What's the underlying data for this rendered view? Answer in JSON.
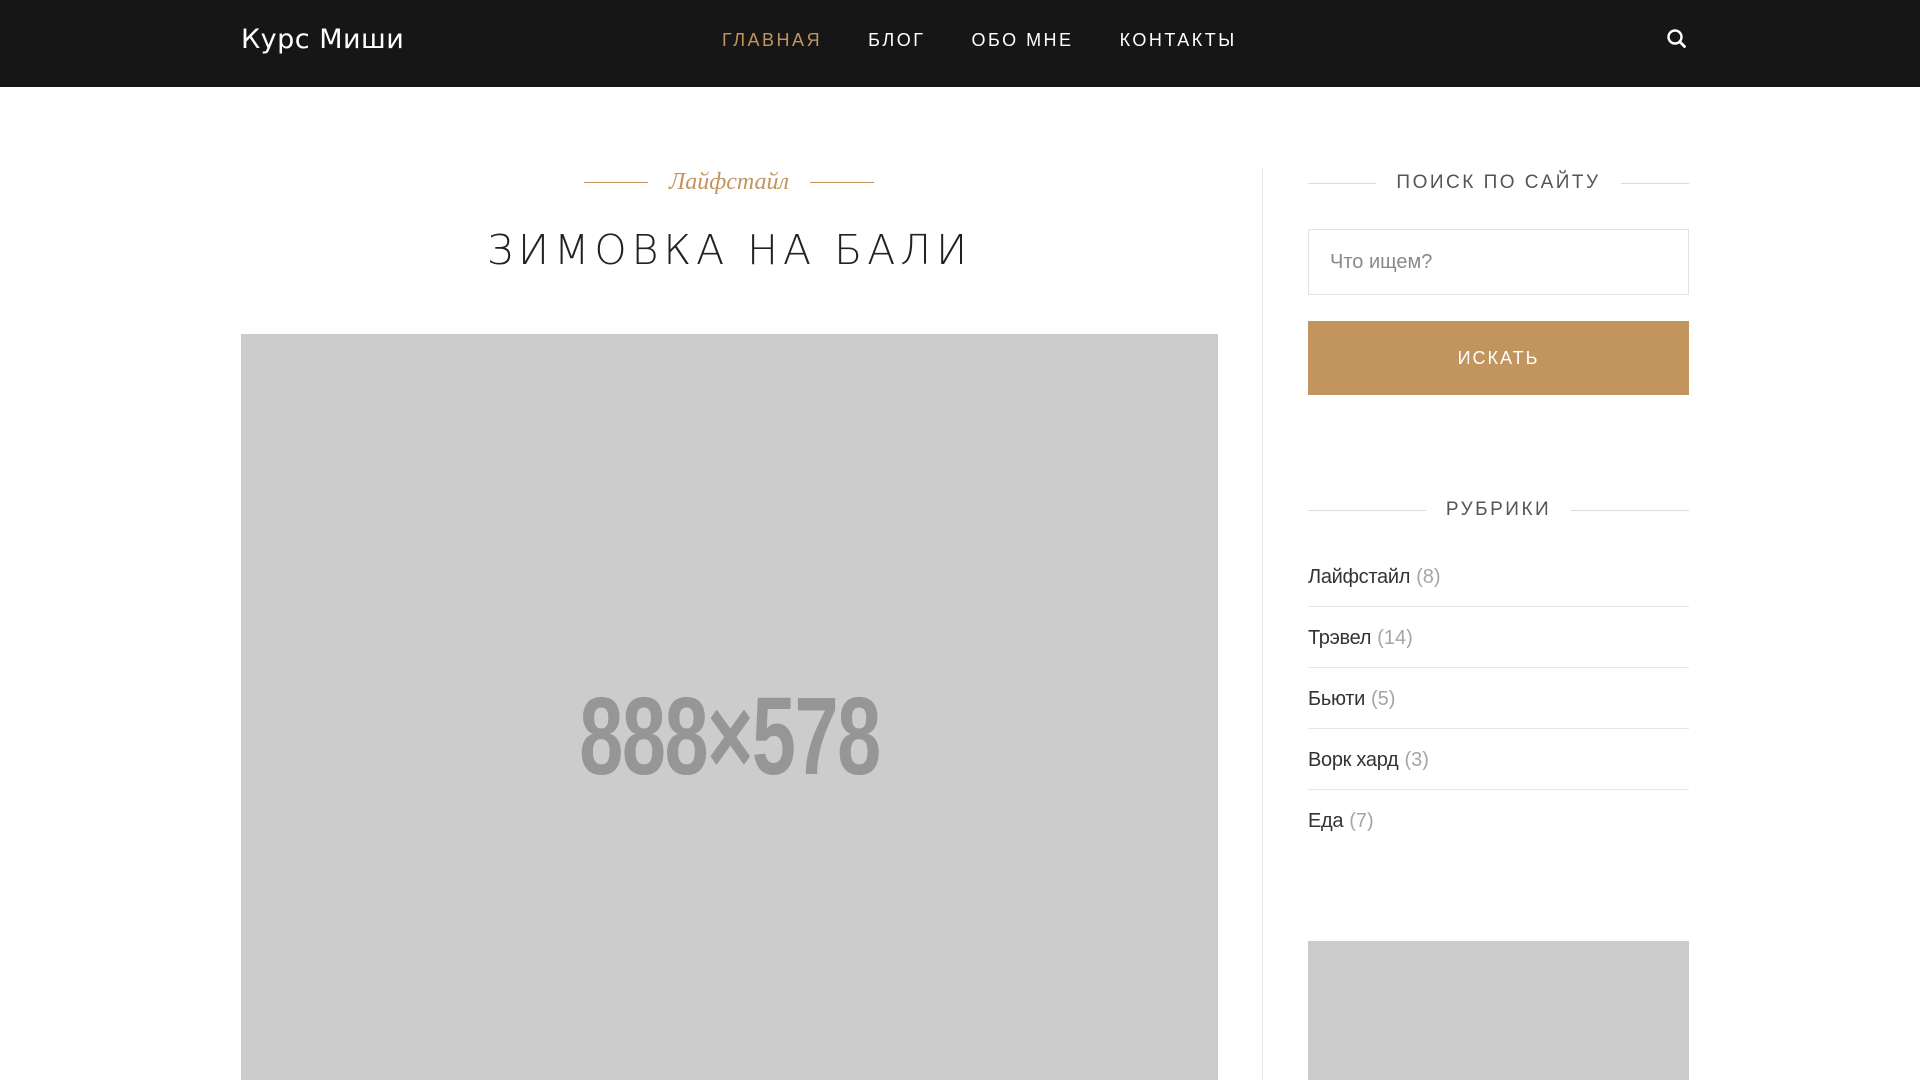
{
  "header": {
    "logo": "Курс Миши",
    "nav": [
      {
        "label": "ГЛАВНАЯ",
        "active": true
      },
      {
        "label": "БЛОГ",
        "active": false
      },
      {
        "label": "ОБО МНЕ",
        "active": false
      },
      {
        "label": "КОНТАКТЫ",
        "active": false
      }
    ],
    "search_icon": "search-icon"
  },
  "post": {
    "category": "Лайфстайл",
    "title": "ЗИМОВКА НА БАЛИ",
    "image_placeholder": "888×578"
  },
  "sidebar": {
    "search_title": "ПОИСК ПО САЙТУ",
    "search_placeholder": "Что ищем?",
    "search_button": "ИСКАТЬ",
    "categories_title": "РУБРИКИ",
    "categories": [
      {
        "name": "Лайфстайл",
        "count": "(8)"
      },
      {
        "name": "Трэвел",
        "count": "(14)"
      },
      {
        "name": "Бьюти",
        "count": "(5)"
      },
      {
        "name": "Ворк хард",
        "count": "(3)"
      },
      {
        "name": "Еда",
        "count": "(7)"
      }
    ]
  },
  "colors": {
    "header_bg": "#161616",
    "accent": "#c2955e",
    "placeholder_bg": "#cccccc"
  }
}
